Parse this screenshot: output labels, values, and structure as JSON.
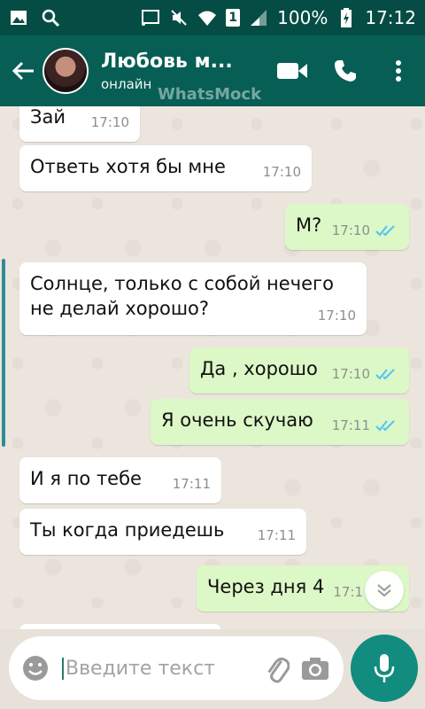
{
  "status_bar": {
    "battery": "100%",
    "time": "17:12",
    "sim": "1",
    "icons": [
      "image-icon",
      "search-icon",
      "cast-icon",
      "mute-icon",
      "wifi-icon",
      "signal-icon",
      "battery-charging-icon"
    ]
  },
  "header": {
    "contact_name": "Любовь м...",
    "contact_status": "онлайн",
    "watermark": "WhatsMock",
    "icons": [
      "back-arrow-icon",
      "video-call-icon",
      "phone-icon",
      "more-vert-icon"
    ]
  },
  "messages": [
    {
      "dir": "in",
      "text": "Зай",
      "time": "17:10"
    },
    {
      "dir": "in",
      "text": "Ответь хотя бы мне",
      "time": "17:10"
    },
    {
      "dir": "out",
      "text": "М?",
      "time": "17:10",
      "read": true
    },
    {
      "dir": "in",
      "text_line1": "Солнце, только с собой нечего",
      "text_line2": "не делай хорошо?",
      "time": "17:10"
    },
    {
      "dir": "out",
      "text": "Да , хорошо",
      "time": "17:10",
      "read": true
    },
    {
      "dir": "out",
      "text": "Я очень скучаю",
      "time": "17:11",
      "read": true
    },
    {
      "dir": "in",
      "text": "И я по тебе",
      "time": "17:11"
    },
    {
      "dir": "in",
      "text": "Ты когда приедешь",
      "time": "17:11"
    },
    {
      "dir": "out",
      "text": "Через дня 4",
      "time": "17:1",
      "read": false
    }
  ],
  "input": {
    "placeholder": "Введите текст",
    "icons": [
      "emoji-icon",
      "attach-icon",
      "camera-icon",
      "mic-icon"
    ]
  },
  "colors": {
    "header": "#075e54",
    "status_bar": "#054d44",
    "outgoing_bubble": "#dcf8c6",
    "incoming_bubble": "#ffffff",
    "accent": "#128c7e",
    "read_tick": "#4fc3f7"
  }
}
